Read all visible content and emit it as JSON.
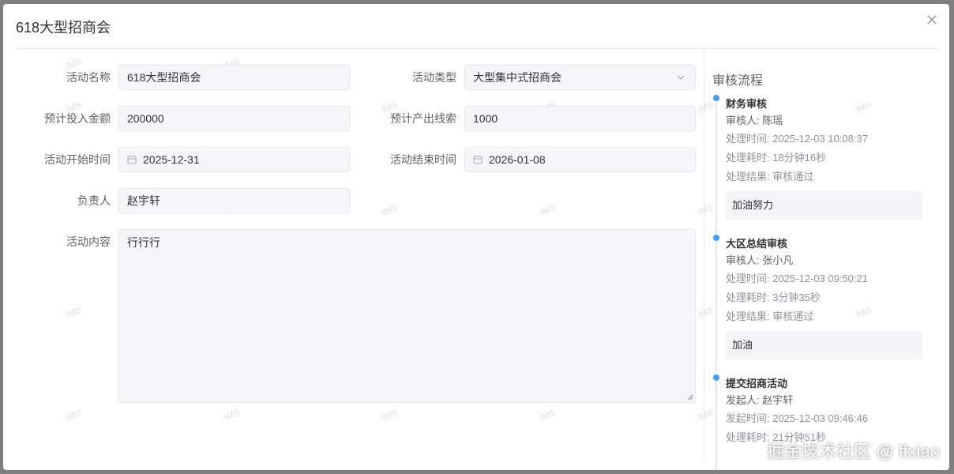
{
  "dialog": {
    "title": "618大型招商会"
  },
  "form": {
    "activity_name": {
      "label": "活动名称",
      "value": "618大型招商会"
    },
    "activity_type": {
      "label": "活动类型",
      "value": "大型集中式招商会"
    },
    "budget": {
      "label": "预计投入金额",
      "value": "200000"
    },
    "leads": {
      "label": "预计产出线索",
      "value": "1000"
    },
    "start_time": {
      "label": "活动开始时间",
      "value": "2025-12-31"
    },
    "end_time": {
      "label": "活动结束时间",
      "value": "2026-01-08"
    },
    "owner": {
      "label": "负责人",
      "value": "赵宇轩"
    },
    "content": {
      "label": "活动内容",
      "value": "行行行"
    }
  },
  "review": {
    "title": "审核流程",
    "steps": [
      {
        "title": "财务审核",
        "person": "审核人: 陈瑶",
        "time": "处理时间: 2025-12-03 10:08:37",
        "duration": "处理耗时: 18分钟16秒",
        "result": "处理结果: 审核通过",
        "comment": "加油努力"
      },
      {
        "title": "大区总结审核",
        "person": "审核人: 张小凡",
        "time": "处理时间: 2025-12-03 09:50:21",
        "duration": "处理耗时: 3分钟35秒",
        "result": "处理结果: 审核通过",
        "comment": "加油"
      },
      {
        "title": "提交招商活动",
        "person": "发起人: 赵宇轩",
        "time": "发起时间: 2025-12-03 09:46:46",
        "duration": "处理耗时: 21分钟51秒"
      }
    ]
  },
  "watermark_text": "IMS",
  "brand_overlay": "掘金技术社区 @ ffxiao",
  "colors": {
    "accent": "#409eff",
    "field_bg": "#f5f7fa"
  }
}
